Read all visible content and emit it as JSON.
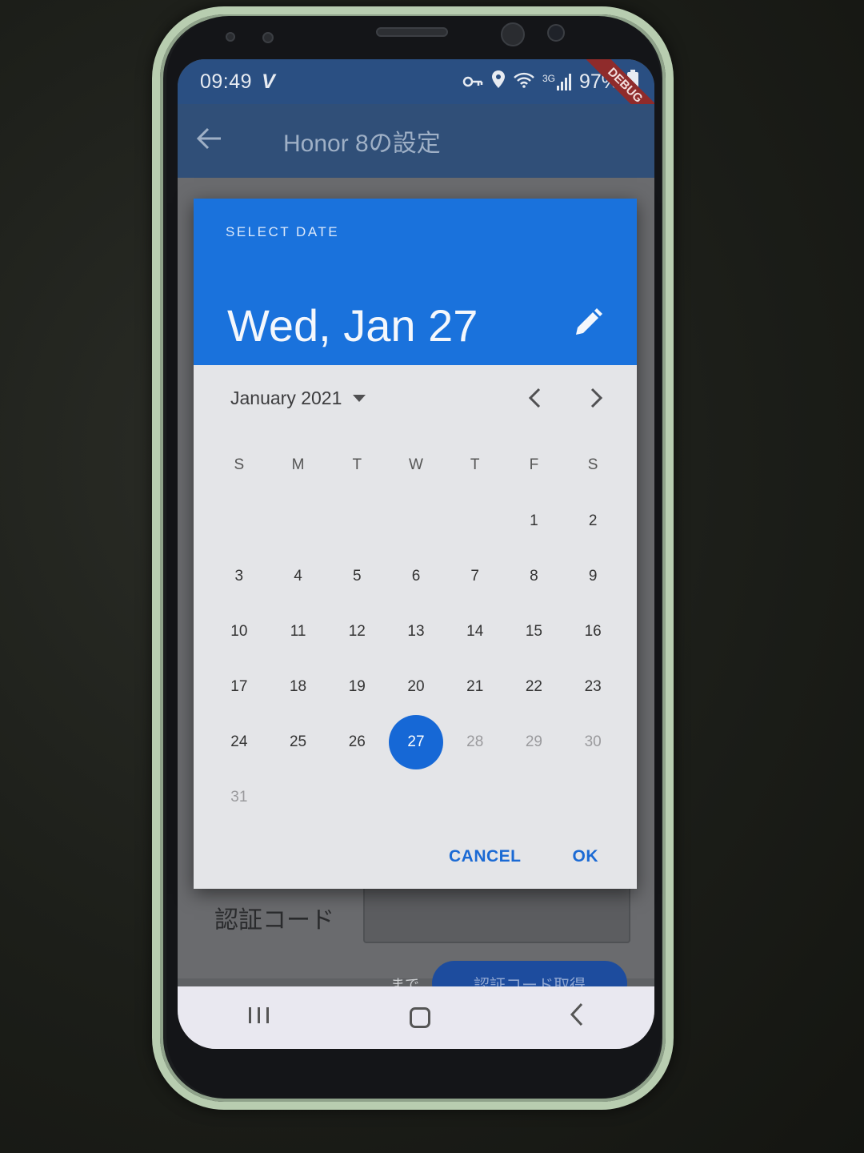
{
  "status_bar": {
    "time": "09:49",
    "check": "V",
    "battery": "97%",
    "network": "3G",
    "debug_label": "DEBUG",
    "icons": [
      "key-icon",
      "location-icon",
      "wifi-icon",
      "signal-icon",
      "battery-icon"
    ]
  },
  "app_bar": {
    "back_icon": "arrow-left-icon",
    "title": "Honor 8の設定"
  },
  "background_page": {
    "verify_label": "認証コード",
    "made_text": "まで",
    "verify_button": "認証コード取得"
  },
  "date_picker": {
    "header_label": "SELECT DATE",
    "selected_date": "Wed, Jan 27",
    "month_label": "January 2021",
    "weekdays": [
      "S",
      "M",
      "T",
      "W",
      "T",
      "F",
      "S"
    ],
    "days": [
      {
        "d": ""
      },
      {
        "d": ""
      },
      {
        "d": ""
      },
      {
        "d": ""
      },
      {
        "d": ""
      },
      {
        "d": "1"
      },
      {
        "d": "2"
      },
      {
        "d": "3"
      },
      {
        "d": "4"
      },
      {
        "d": "5"
      },
      {
        "d": "6"
      },
      {
        "d": "7"
      },
      {
        "d": "8"
      },
      {
        "d": "9"
      },
      {
        "d": "10"
      },
      {
        "d": "11"
      },
      {
        "d": "12"
      },
      {
        "d": "13"
      },
      {
        "d": "14"
      },
      {
        "d": "15"
      },
      {
        "d": "16"
      },
      {
        "d": "17"
      },
      {
        "d": "18"
      },
      {
        "d": "19"
      },
      {
        "d": "20"
      },
      {
        "d": "21"
      },
      {
        "d": "22"
      },
      {
        "d": "23"
      },
      {
        "d": "24"
      },
      {
        "d": "25"
      },
      {
        "d": "26"
      },
      {
        "d": "27",
        "selected": true
      },
      {
        "d": "28",
        "disabled": true
      },
      {
        "d": "29",
        "disabled": true
      },
      {
        "d": "30",
        "disabled": true
      },
      {
        "d": "31",
        "disabled": true
      }
    ],
    "cancel_label": "CANCEL",
    "ok_label": "OK",
    "accent_color": "#1a72dc"
  },
  "nav_bar": {
    "recent_icon": "recent-apps-icon",
    "home_icon": "home-icon",
    "back_icon": "back-chevron-icon"
  }
}
